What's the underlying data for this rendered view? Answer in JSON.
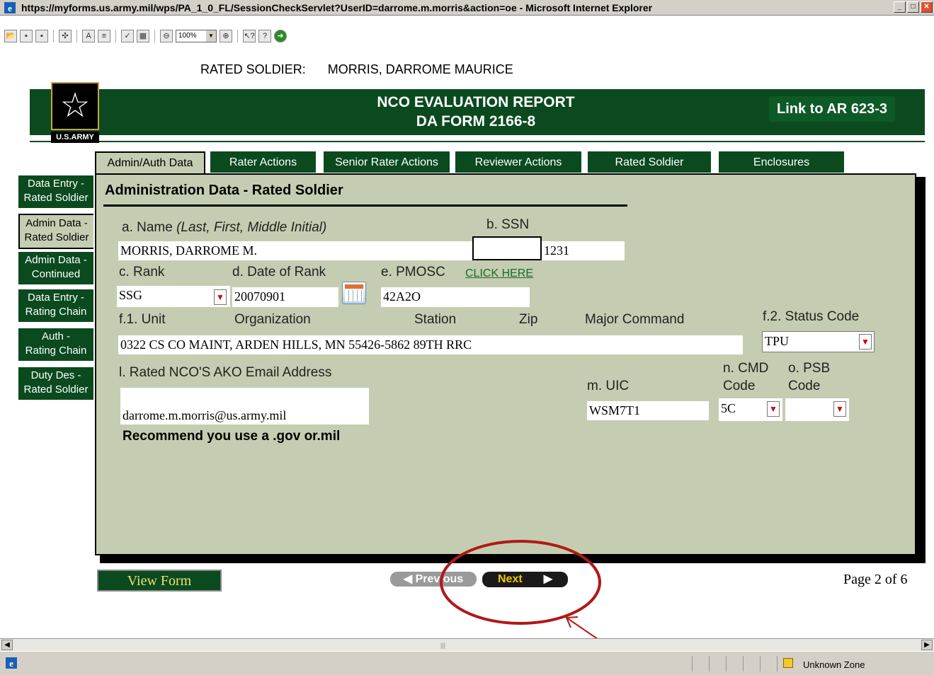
{
  "window": {
    "title": "https://myforms.us.army.mil/wps/PA_1_0_FL/SessionCheckServlet?UserID=darrome.m.morris&action=oe - Microsoft Internet Explorer"
  },
  "toolbar": {
    "zoom": "100%",
    "icons": [
      "open-icon",
      "save-icon",
      "save-copy-icon",
      "plugin-icon",
      "text-icon",
      "form-icon",
      "spellcheck-icon",
      "form-fill-icon",
      "zoom-out-icon",
      "zoom-in-icon",
      "whats-this-icon",
      "help-icon",
      "go-icon"
    ]
  },
  "header": {
    "rated_soldier_label": "RATED SOLDIER:",
    "rated_soldier_name": "MORRIS, DARROME MAURICE",
    "title_line1": "NCO EVALUATION REPORT",
    "title_line2": "DA FORM 2166-8",
    "ar_link": "Link to AR 623-3",
    "logo_text": "U.S.ARMY"
  },
  "tabs": [
    {
      "label": "Admin/Auth Data",
      "active": true
    },
    {
      "label": "Rater Actions",
      "active": false
    },
    {
      "label": "Senior Rater Actions",
      "active": false
    },
    {
      "label": "Reviewer Actions",
      "active": false
    },
    {
      "label": "Rated Soldier",
      "active": false
    },
    {
      "label": "Enclosures",
      "active": false
    }
  ],
  "sidebar": {
    "items": [
      {
        "line1": "Data Entry -",
        "line2": "Rated Soldier",
        "active": false
      },
      {
        "line1": "Admin Data -",
        "line2": "Rated Soldier",
        "active": true
      },
      {
        "line1": "Admin Data -",
        "line2": "Continued",
        "active": false
      },
      {
        "line1": "Data Entry -",
        "line2": "Rating Chain",
        "active": false
      },
      {
        "line1": "Auth -",
        "line2": "Rating Chain",
        "active": false
      },
      {
        "line1": "Duty Des -",
        "line2": "Rated Soldier",
        "active": false
      }
    ]
  },
  "form": {
    "section_title": "Administration Data - Rated Soldier",
    "name_label": "a. Name",
    "name_hint": "(Last, First, Middle Initial)",
    "name_value": "MORRIS, DARROME M.",
    "ssn_label": "b. SSN",
    "ssn_masked": "",
    "ssn_last4": "1231",
    "rank_label": "c. Rank",
    "rank_value": "SSG",
    "date_rank_label": "d. Date of Rank",
    "date_rank_value": "20070901",
    "pmosc_label": "e. PMOSC",
    "click_here": "CLICK HERE",
    "pmosc_value": "42A2O",
    "unit_label": "f.1. Unit",
    "org_label": "Organization",
    "station_label": "Station",
    "zip_label": "Zip",
    "major_cmd_label": "Major Command",
    "unit_value": "0322 CS CO MAINT, ARDEN HILLS, MN  55426-5862                89TH RRC",
    "status_code_label": "f.2. Status Code",
    "status_code_value": "TPU",
    "email_label": "l. Rated NCO'S AKO Email Address",
    "email_value": "darrome.m.morris@us.army.mil",
    "email_note": "Recommend you use a .gov or.mil",
    "uic_label": "m. UIC",
    "uic_value": "WSM7T1",
    "cmd_code_label1": "n. CMD",
    "cmd_code_label2": "Code",
    "cmd_code_value": "5C",
    "psb_label1": "o. PSB",
    "psb_label2": "Code",
    "psb_value": ""
  },
  "footer": {
    "view_form": "View Form",
    "previous": "Previous",
    "next": "Next",
    "page_indicator": "Page 2 of 6"
  },
  "statusbar": {
    "zone": "Unknown Zone"
  },
  "colors": {
    "army_green": "#0b4a1f",
    "panel_bg": "#c4cdb1",
    "annotation_red": "#b01818"
  }
}
